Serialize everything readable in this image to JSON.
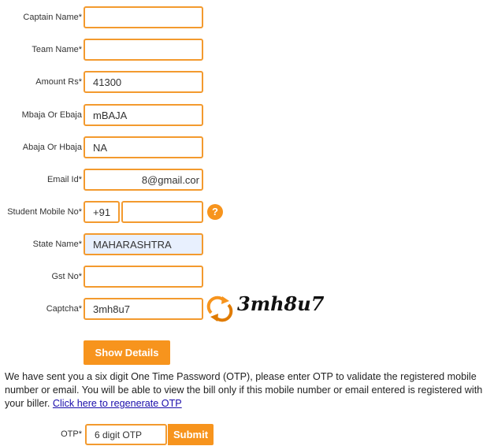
{
  "form": {
    "captain_name": {
      "label": "Captain Name*",
      "value": ""
    },
    "team_name": {
      "label": "Team Name*",
      "value": ""
    },
    "amount": {
      "label": "Amount Rs*",
      "value": "41300"
    },
    "mbaja": {
      "label": "Mbaja Or Ebaja",
      "value": "mBAJA"
    },
    "abaja": {
      "label": "Abaja Or Hbaja",
      "value": "NA"
    },
    "email": {
      "label": "Email Id*",
      "value": "8@gmail.cor"
    },
    "mobile": {
      "label": "Student Mobile No*",
      "prefix": "+91",
      "value": "",
      "help": "?"
    },
    "state": {
      "label": "State Name*",
      "value": "MAHARASHTRA"
    },
    "gst": {
      "label": "Gst No*",
      "value": ""
    },
    "captcha": {
      "label": "Captcha*",
      "value": "3mh8u7",
      "image_text": "3mh8u7"
    },
    "show_details_label": "Show Details"
  },
  "info": {
    "text": "We have sent you a six digit One Time Password (OTP), please enter OTP to validate the registered mobile number or email. You will be able to view the bill only if this mobile number or email entered is registered with your biller. ",
    "link": "Click here to regenerate OTP"
  },
  "otp": {
    "label": "OTP*",
    "value": "6 digit OTP",
    "submit_label": "Submit"
  },
  "colors": {
    "accent": "#f7941d",
    "border": "#f39a2e",
    "link": "#1a0dab",
    "autofill": "#e8f0fe"
  },
  "icons": {
    "help": "question-circle-icon",
    "captcha_refresh": "refresh-arrows-icon"
  }
}
